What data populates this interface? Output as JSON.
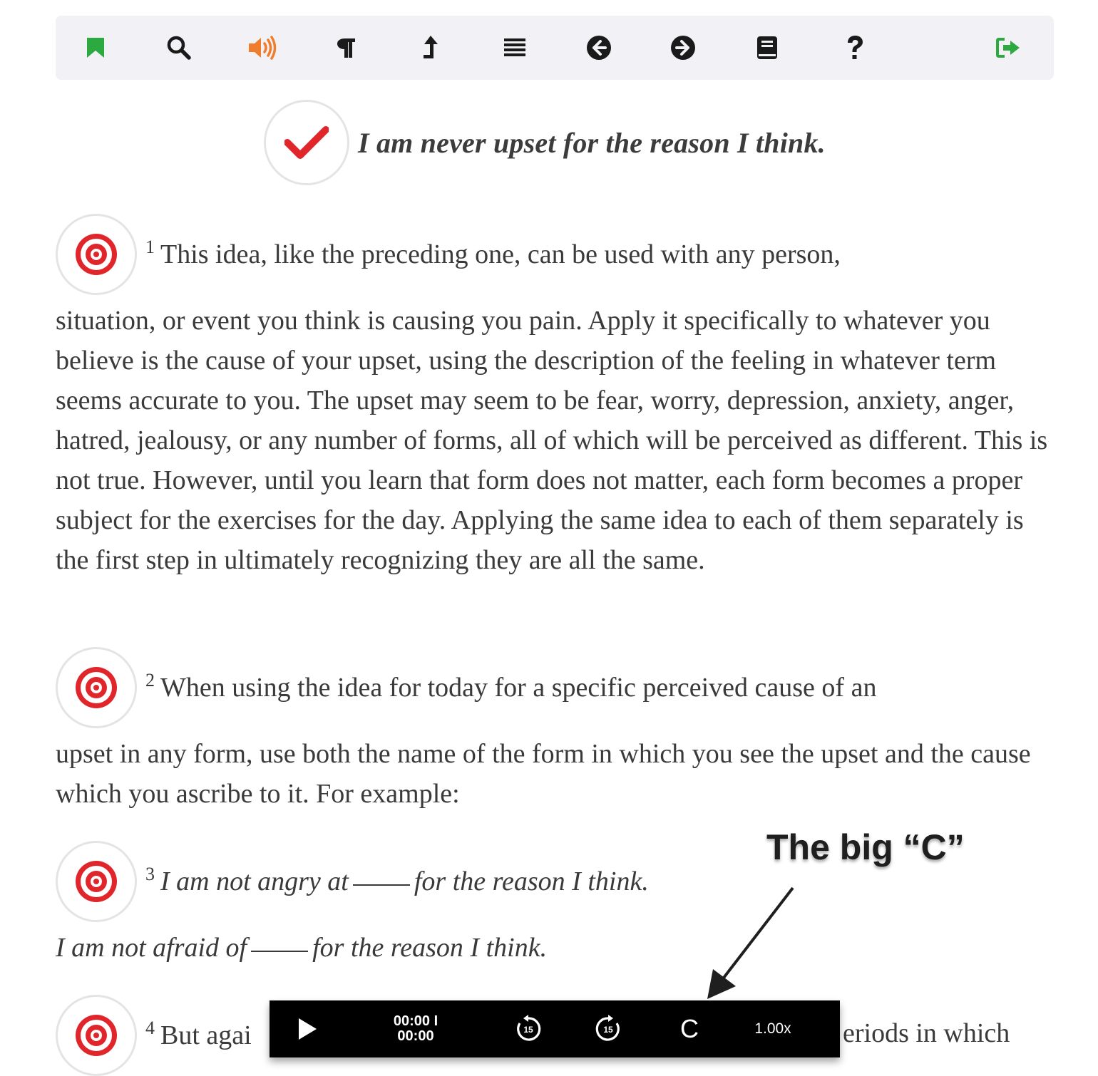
{
  "toolbar": {
    "items": [
      {
        "name": "bookmark-icon",
        "color": "#2daa3f"
      },
      {
        "name": "search-icon",
        "color": "#1a1a1a"
      },
      {
        "name": "audio-icon",
        "color": "#ef7d2d"
      },
      {
        "name": "paragraph-icon",
        "color": "#1a1a1a"
      },
      {
        "name": "level-up-icon",
        "color": "#1a1a1a"
      },
      {
        "name": "list-icon",
        "color": "#1a1a1a"
      },
      {
        "name": "prev-arrow-icon",
        "color": "#1a1a1a"
      },
      {
        "name": "next-arrow-icon",
        "color": "#1a1a1a"
      },
      {
        "name": "book-icon",
        "color": "#1a1a1a"
      },
      {
        "name": "help-icon",
        "color": "#1a1a1a"
      },
      {
        "name": "sign-out-icon",
        "color": "#2daa3f"
      }
    ]
  },
  "lesson": {
    "title": "I am never upset for the reason I think.",
    "accent": "#e0252b"
  },
  "paragraphs": [
    {
      "number": "1",
      "first_line": "This idea, like the preceding one, can be used with any person,",
      "body": "situation, or event you think is causing you pain. Apply it specifically to whatever you believe is the cause of your upset, using the description of the feeling in whatever term seems accurate to you. The upset may seem to be fear, worry, depression, anxiety, anger, hatred, jealousy, or any number of forms, all of which will be perceived as different. This is not true. However, until you learn that form does not matter, each form becomes a proper subject for the exercises for the day. Applying the same idea to each of them separately is the first step in ultimately recognizing they are all the same."
    },
    {
      "number": "2",
      "first_line": "When using the idea for today for a specific perceived cause of an",
      "body": "upset in any form, use both the name of the form in which you see the upset and the cause which you ascribe to it. For example:"
    },
    {
      "number": "3",
      "line1_a": "I am not angry at",
      "line1_b": "for the reason I think.",
      "line2_a": "I am not afraid of",
      "line2_b": "for the reason I think."
    },
    {
      "number": "4",
      "first_line_start": "But agai",
      "first_line_end": "eriods in which"
    }
  ],
  "player": {
    "time_current": "00:00 I",
    "time_total": "00:00",
    "rewind_label": "15",
    "forward_label": "15",
    "clear_label": "C",
    "rate": "1.00x"
  },
  "annotation": {
    "text": "The big “C”"
  }
}
